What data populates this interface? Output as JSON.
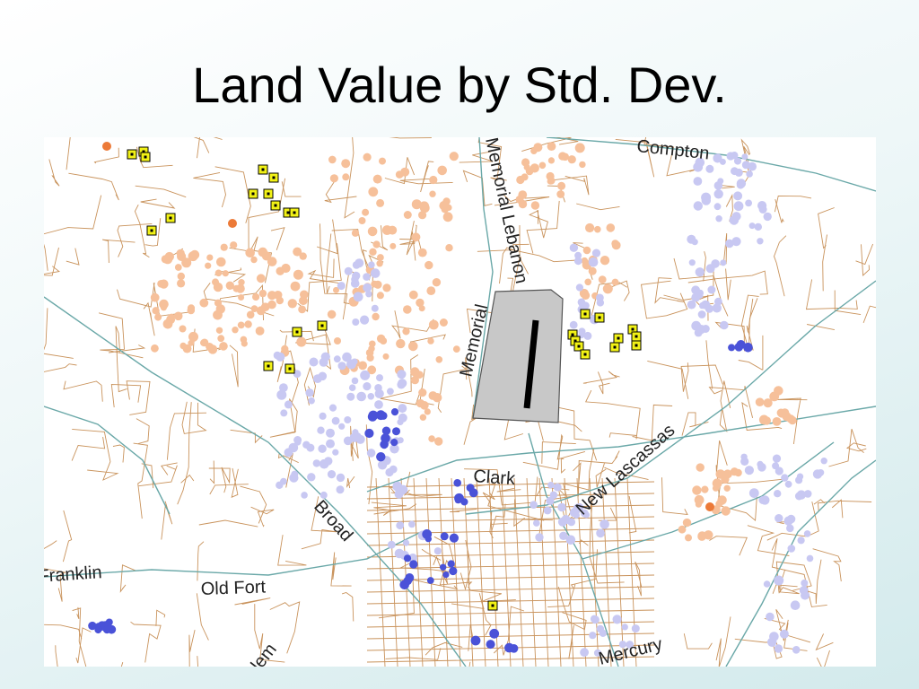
{
  "slide": {
    "title": "Land Value by Std. Dev."
  },
  "map": {
    "street_labels": [
      {
        "id": "compton",
        "text": "Compton"
      },
      {
        "id": "memorial-lebanon",
        "text": "Memorial Lebanon"
      },
      {
        "id": "memorial",
        "text": "Memorial"
      },
      {
        "id": "clark",
        "text": "Clark"
      },
      {
        "id": "new-lascassas",
        "text": "New Lascassas"
      },
      {
        "id": "broad",
        "text": "Broad"
      },
      {
        "id": "franklin",
        "text": "Franklin"
      },
      {
        "id": "old-fort",
        "text": "Old Fort"
      },
      {
        "id": "mercury",
        "text": "Mercury"
      },
      {
        "id": "church",
        "text": "lem"
      }
    ],
    "colors": {
      "background": "#ffffff",
      "streets": "#c9935c",
      "highways": "#6aa8a8",
      "parcel_light_orange": "#f6c09a",
      "parcel_dark_orange": "#ec7a38",
      "parcel_light_blue": "#c8c8f2",
      "parcel_dark_blue": "#4a52d8",
      "marker_yellow": "#f2f216",
      "airport_fill": "#c8c8c8"
    }
  }
}
